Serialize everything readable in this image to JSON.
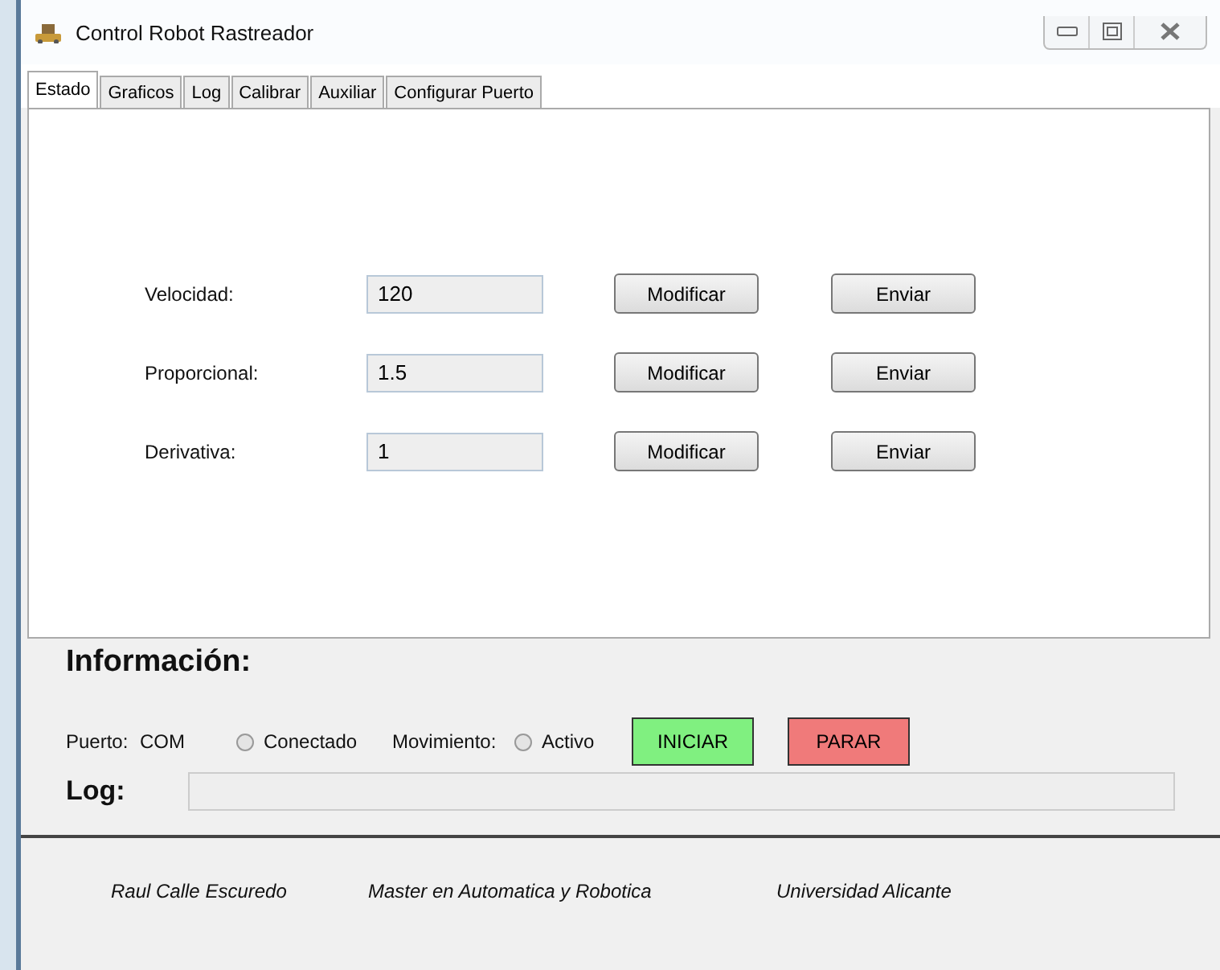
{
  "window": {
    "title": "Control Robot Rastreador"
  },
  "tabs": [
    {
      "label": "Estado",
      "selected": true
    },
    {
      "label": "Graficos",
      "selected": false
    },
    {
      "label": "Log",
      "selected": false
    },
    {
      "label": "Calibrar",
      "selected": false
    },
    {
      "label": "Auxiliar",
      "selected": false
    },
    {
      "label": "Configurar Puerto",
      "selected": false
    }
  ],
  "parameters": [
    {
      "label": "Velocidad:",
      "value": "120",
      "modify": "Modificar",
      "send": "Enviar"
    },
    {
      "label": "Proporcional:",
      "value": "1.5",
      "modify": "Modificar",
      "send": "Enviar"
    },
    {
      "label": "Derivativa:",
      "value": "1",
      "modify": "Modificar",
      "send": "Enviar"
    }
  ],
  "info": {
    "heading": "Información:",
    "port_label": "Puerto:",
    "port_value": "COM",
    "connected": {
      "label": "Conectado",
      "checked": false
    },
    "movement_label": "Movimiento:",
    "active": {
      "label": "Activo",
      "checked": false
    },
    "start": "INICIAR",
    "stop": "PARAR",
    "log_label": "Log:"
  },
  "footer": [
    "Raul Calle Escuredo",
    "Master en Automatica y Robotica",
    "Universidad Alicante"
  ]
}
